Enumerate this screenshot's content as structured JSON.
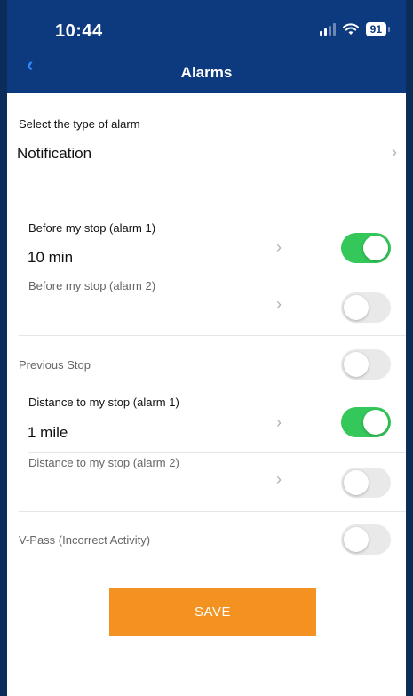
{
  "status_bar": {
    "time": "10:44",
    "battery": "91"
  },
  "header": {
    "title": "Alarms",
    "back_icon": "chevron-left-icon"
  },
  "alarm_type": {
    "label": "Select the type of alarm",
    "value": "Notification"
  },
  "rows": [
    {
      "label": "Before my stop (alarm 1)",
      "value": "10 min",
      "enabled": true
    },
    {
      "label": "Before my stop (alarm 2)",
      "value": "",
      "enabled": false
    },
    {
      "label": "Previous Stop",
      "value": "",
      "enabled": false
    },
    {
      "label": "Distance to my stop (alarm 1)",
      "value": "1 mile",
      "enabled": true
    },
    {
      "label": "Distance to my stop (alarm 2)",
      "value": "",
      "enabled": false
    },
    {
      "label": "V-Pass (Incorrect Activity)",
      "value": "",
      "enabled": false
    }
  ],
  "save_label": "SAVE",
  "colors": {
    "header": "#0d3a7f",
    "accent": "#f39220",
    "toggle_on": "#34c759"
  }
}
